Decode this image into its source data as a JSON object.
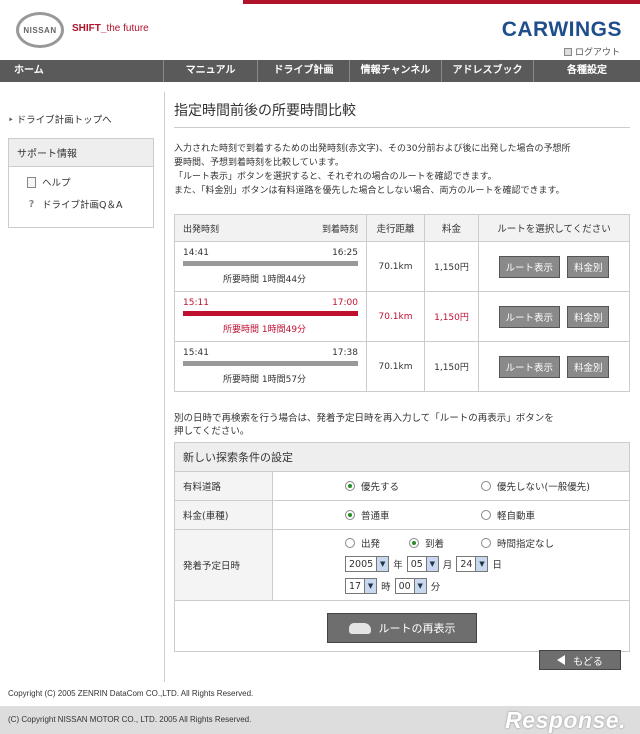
{
  "header": {
    "brand": "NISSAN",
    "slogan_shift": "SHIFT_",
    "slogan_rest": "the future",
    "carwings": "CARWINGS",
    "logout": "ログアウト"
  },
  "nav": {
    "home": "ホーム",
    "items": [
      "マニュアル",
      "ドライブ計画",
      "情報チャンネル",
      "アドレスブック",
      "各種設定"
    ]
  },
  "sidebar": {
    "top_link": "ドライブ計画トップへ",
    "support_title": "サポート情報",
    "help": "ヘルプ",
    "qa": "ドライブ計画Q＆A"
  },
  "main": {
    "title": "指定時間前後の所要時間比較",
    "intro": [
      "入力された時刻で到着するための出発時刻(赤文字)、その30分前および後に出発した場合の予想所",
      "要時間、予想到着時刻を比較しています。",
      "「ルート表示」ボタンを選択すると、それぞれの場合のルートを確認できます。",
      "また、「料金別」ボタンは有料道路を優先した場合としない場合、両方のルートを確認できます。"
    ],
    "table": {
      "headers": {
        "depart": "出発時刻",
        "arrive": "到着時刻",
        "distance": "走行距離",
        "fee": "料金",
        "select": "ルートを選択してください"
      },
      "rows": [
        {
          "depart": "14:41",
          "arrive": "16:25",
          "duration": "所要時間  1時間44分",
          "distance": "70.1km",
          "fee": "1,150円",
          "route_btn": "ルート表示",
          "fee_btn": "料金別"
        },
        {
          "depart": "15:11",
          "arrive": "17:00",
          "duration": "所要時間  1時間49分",
          "distance": "70.1km",
          "fee": "1,150円",
          "route_btn": "ルート表示",
          "fee_btn": "料金別"
        },
        {
          "depart": "15:41",
          "arrive": "17:38",
          "duration": "所要時間  1時間57分",
          "distance": "70.1km",
          "fee": "1,150円",
          "route_btn": "ルート表示",
          "fee_btn": "料金別"
        }
      ]
    },
    "desc_line1": "別の日時で再検索を行う場合は、発着予定日時を再入力して「ルートの再表示」ボタンを",
    "desc_line2": "押してください。",
    "conditions": {
      "title": "新しい探索条件の設定",
      "toll_label": "有料道路",
      "toll_opt1": "優先する",
      "toll_opt2": "優先しない(一般優先)",
      "fee_label": "料金(車種)",
      "fee_opt1": "普通車",
      "fee_opt2": "軽自動車",
      "date_label": "発着予定日時",
      "time_opt1": "出発",
      "time_opt2": "到着",
      "time_opt3": "時間指定なし",
      "year": "2005",
      "year_unit": "年",
      "month": "05",
      "month_unit": "月",
      "day": "24",
      "day_unit": "日",
      "hour": "17",
      "hour_unit": "時",
      "minute": "00",
      "minute_unit": "分",
      "redisplay_btn": "ルートの再表示"
    },
    "back_btn": "もどる"
  },
  "footer": {
    "copy1": "Copyright (C) 2005 ZENRIN DataCom CO.,LTD. All Rights Reserved.",
    "copy2": "(C) Copyright NISSAN MOTOR CO., LTD. 2005 All Rights Reserved.",
    "watermark": "Response."
  },
  "colors": {
    "accent_red": "#c01030",
    "nav_bg": "#5a5a5a",
    "carwings_blue": "#1f4e8c"
  }
}
